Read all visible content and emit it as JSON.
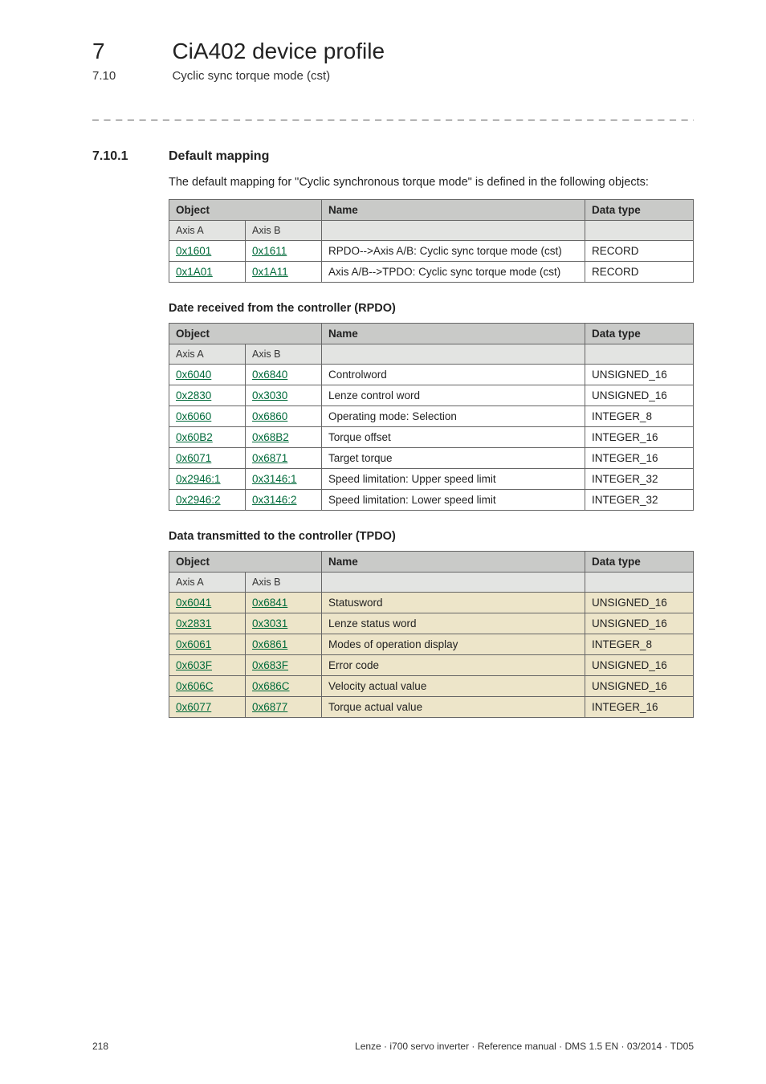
{
  "header": {
    "chapter_num": "7",
    "chapter_title": "CiA402 device profile",
    "section_num": "7.10",
    "section_title": "Cyclic sync torque mode (cst)"
  },
  "section": {
    "num": "7.10.1",
    "title": "Default mapping",
    "intro": "The default mapping for \"Cyclic synchronous torque mode\" is defined in the following objects:"
  },
  "labels": {
    "object": "Object",
    "name": "Name",
    "data_type": "Data type",
    "axis_a": "Axis A",
    "axis_b": "Axis B",
    "rpdo_heading": "Date received from the controller (RPDO)",
    "tpdo_heading": "Data transmitted to the controller (TPDO)"
  },
  "table_mapping": [
    {
      "a": "0x1601",
      "b": "0x1611",
      "name": "RPDO-->Axis A/B: Cyclic sync torque mode (cst)",
      "type": "RECORD"
    },
    {
      "a": "0x1A01",
      "b": "0x1A11",
      "name": "Axis A/B-->TPDO: Cyclic sync torque mode (cst)",
      "type": "RECORD"
    }
  ],
  "table_rpdo": [
    {
      "a": "0x6040",
      "b": "0x6840",
      "name": "Controlword",
      "type": "UNSIGNED_16"
    },
    {
      "a": "0x2830",
      "b": "0x3030",
      "name": "Lenze control word",
      "type": "UNSIGNED_16"
    },
    {
      "a": "0x6060",
      "b": "0x6860",
      "name": "Operating mode: Selection",
      "type": "INTEGER_8"
    },
    {
      "a": "0x60B2",
      "b": "0x68B2",
      "name": "Torque offset",
      "type": "INTEGER_16"
    },
    {
      "a": "0x6071",
      "b": "0x6871",
      "name": "Target torque",
      "type": "INTEGER_16"
    },
    {
      "a": "0x2946:1",
      "b": "0x3146:1",
      "name": "Speed limitation: Upper speed limit",
      "type": "INTEGER_32"
    },
    {
      "a": "0x2946:2",
      "b": "0x3146:2",
      "name": "Speed limitation: Lower speed limit",
      "type": "INTEGER_32"
    }
  ],
  "table_tpdo": [
    {
      "a": "0x6041",
      "b": "0x6841",
      "name": "Statusword",
      "type": "UNSIGNED_16"
    },
    {
      "a": "0x2831",
      "b": "0x3031",
      "name": "Lenze status word",
      "type": "UNSIGNED_16"
    },
    {
      "a": "0x6061",
      "b": "0x6861",
      "name": "Modes of operation display",
      "type": "INTEGER_8"
    },
    {
      "a": "0x603F",
      "b": "0x683F",
      "name": "Error code",
      "type": "UNSIGNED_16"
    },
    {
      "a": "0x606C",
      "b": "0x686C",
      "name": "Velocity actual value",
      "type": "UNSIGNED_16"
    },
    {
      "a": "0x6077",
      "b": "0x6877",
      "name": "Torque actual value",
      "type": "INTEGER_16"
    }
  ],
  "footer": {
    "page": "218",
    "doc": "Lenze · i700 servo inverter · Reference manual · DMS 1.5 EN · 03/2014 · TD05"
  }
}
